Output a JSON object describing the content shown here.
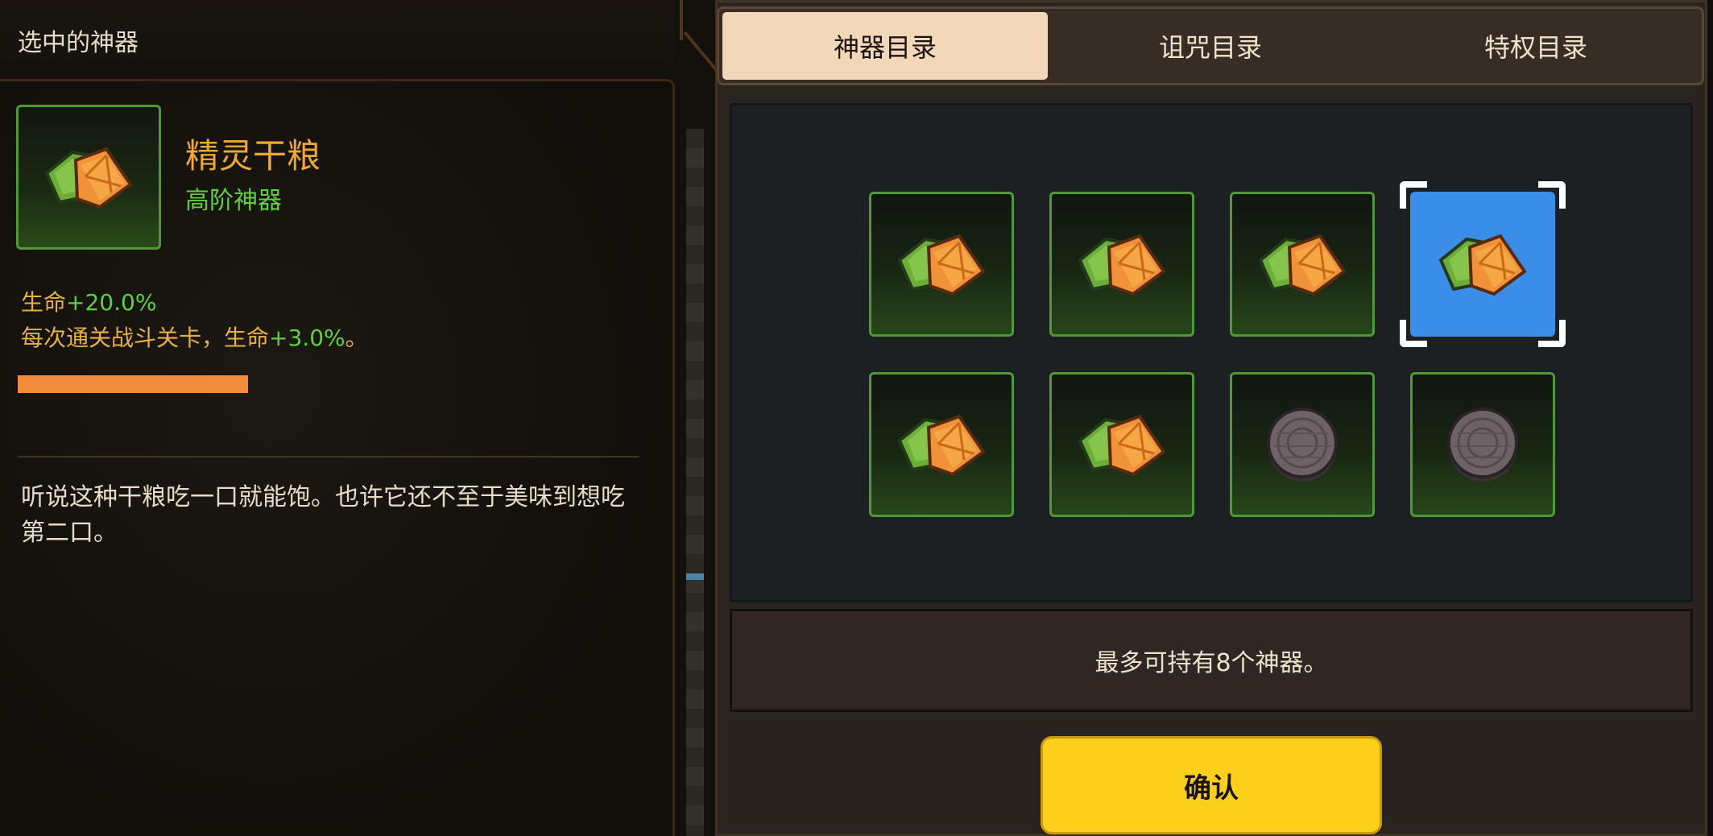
{
  "left": {
    "title": "选中的神器",
    "item": {
      "icon": "dry-ration-icon",
      "name": "精灵干粮",
      "rarity": "高阶神器",
      "stats": [
        {
          "label": "生命",
          "value": "+20.0%",
          "suffix": ""
        },
        {
          "label": "每次通关战斗关卡，生命",
          "value": "+3.0%",
          "suffix": "。"
        }
      ],
      "description": "听说这种干粮吃一口就能饱。也许它还不至于美味到想吃第二口。"
    }
  },
  "tabs": [
    {
      "label": "神器目录",
      "active": true
    },
    {
      "label": "诅咒目录",
      "active": false
    },
    {
      "label": "特权目录",
      "active": false
    }
  ],
  "grid": [
    {
      "icon": "dry-ration-icon",
      "selected": false
    },
    {
      "icon": "dry-ration-icon",
      "selected": false
    },
    {
      "icon": "dry-ration-icon",
      "selected": false
    },
    {
      "icon": "dry-ration-icon",
      "selected": true
    },
    {
      "icon": "dry-ration-icon",
      "selected": false
    },
    {
      "icon": "dry-ration-icon",
      "selected": false
    },
    {
      "icon": "stone-disc-icon",
      "selected": false
    },
    {
      "icon": "stone-disc-icon",
      "selected": false
    }
  ],
  "info": "最多可持有8个神器。",
  "confirm_label": "确认",
  "colors": {
    "accent_gold": "#f0a830",
    "rarity_green": "#5fd03e",
    "selected_blue": "#3a8ee8",
    "confirm_yellow": "#fccf1c"
  }
}
